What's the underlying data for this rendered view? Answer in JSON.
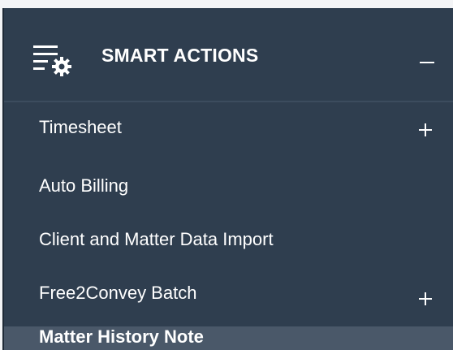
{
  "menu": {
    "header": {
      "title": "SMART ACTIONS",
      "icon": "settings-list-icon",
      "toggle": "minus-icon"
    },
    "items": [
      {
        "label": "Timesheet",
        "expandable": true,
        "icon": "plus-icon"
      },
      {
        "label": "Auto Billing",
        "expandable": false
      },
      {
        "label": "Client and Matter Data Import",
        "expandable": false
      },
      {
        "label": "Free2Convey Batch",
        "expandable": true,
        "icon": "plus-icon"
      },
      {
        "label": "Matter History Note",
        "expandable": false,
        "active": true
      }
    ]
  },
  "colors": {
    "menu_background": "#2f3e4f",
    "active_item_background": "#4a5869",
    "text": "#ffffff",
    "page_background": "#f3f4f6"
  }
}
